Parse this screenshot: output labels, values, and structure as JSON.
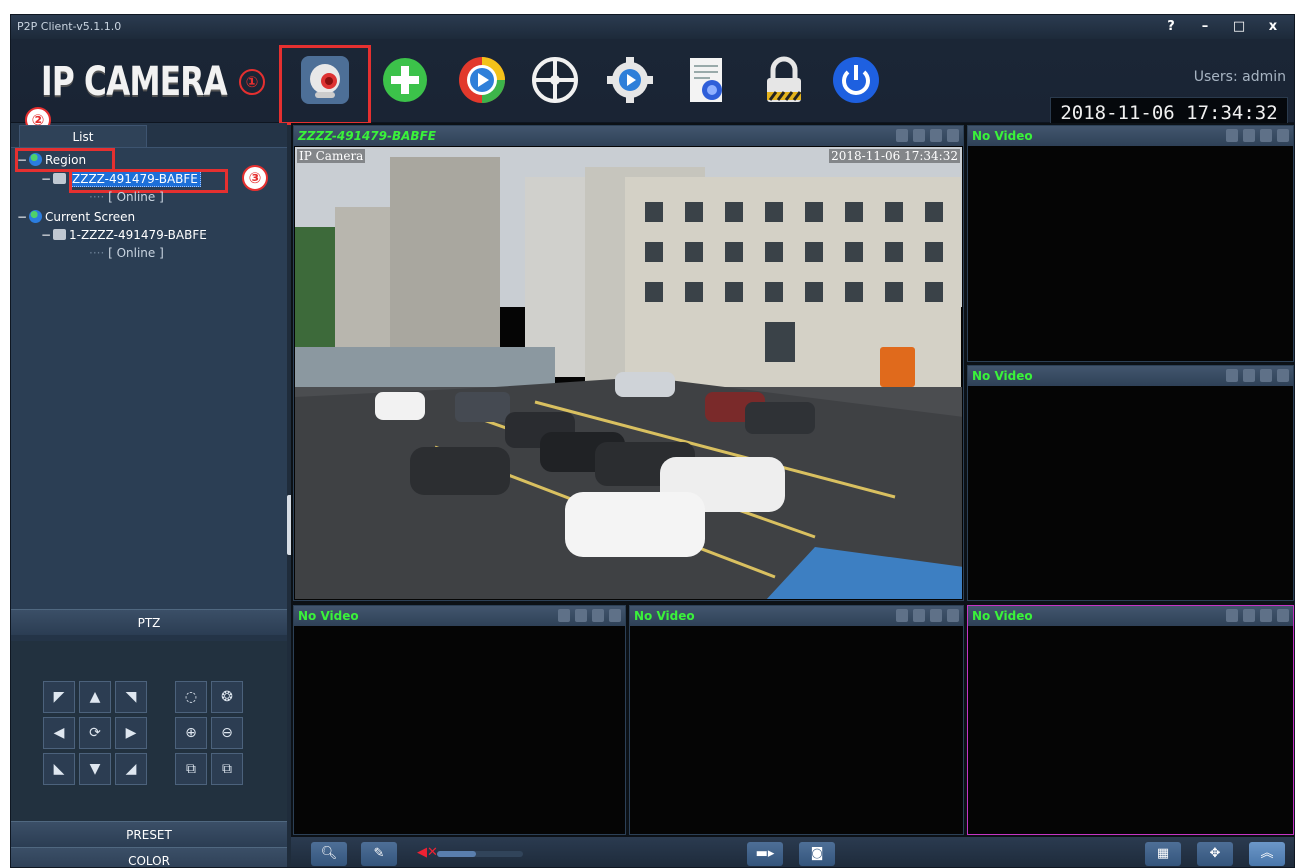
{
  "window": {
    "title": "P2P Client-v5.1.1.0",
    "buttons": [
      "?",
      "–",
      "□",
      "x"
    ]
  },
  "toolbar": {
    "logo": "IP CAMERA",
    "users_label": "Users: admin",
    "clock": "2018-11-06 17:34:32",
    "icons": [
      "monitor-icon",
      "add-device-icon",
      "playback-icon",
      "remote-config-icon",
      "settings-icon",
      "log-icon",
      "lock-icon",
      "power-icon"
    ]
  },
  "annotations": [
    "①",
    "②",
    "③"
  ],
  "left_panel": {
    "list_tab": "List",
    "tree": {
      "region_label": "Region",
      "device_label": "ZZZZ-491479-BABFE",
      "device_status": "[ Online ]",
      "current_screen_label": "Current Screen",
      "screen_device_label": "1-ZZZZ-491479-BABFE",
      "screen_device_status": "[ Online ]"
    },
    "ptz_label": "PTZ",
    "preset_label": "PRESET",
    "color_label": "COLOR"
  },
  "video": {
    "main_pane_title": "ZZZZ-491479-BABFE",
    "osd_name": "IP Camera",
    "osd_time": "2018-11-06 17:34:32",
    "empty_pane_title": "No Video"
  },
  "bottom_bar": {
    "volume_level": 0.45,
    "icons": [
      "search-icon",
      "microphone-icon",
      "speaker-mute-icon",
      "record-icon",
      "snapshot-icon",
      "grid-layout-icon",
      "ptz-control-icon",
      "collapse-icon"
    ]
  },
  "colors": {
    "accent": "#1d6fd8",
    "pane_title": "#3af23a",
    "annotation": "#e53030",
    "active_pane_border": "#c535c5"
  }
}
